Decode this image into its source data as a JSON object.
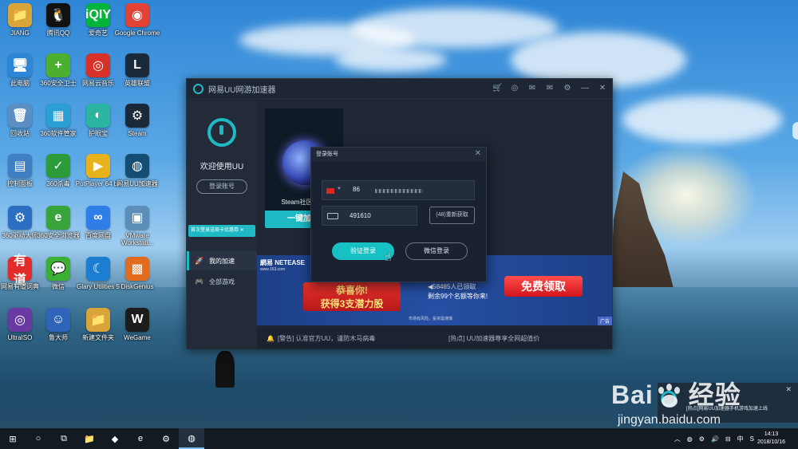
{
  "desktop": {
    "icons": [
      {
        "label": "JIANG",
        "glyph": "📁",
        "color": "#d9a53a"
      },
      {
        "label": "腾讯QQ",
        "glyph": "🐧",
        "color": "#111111"
      },
      {
        "label": "爱奇艺",
        "glyph": "iQIY",
        "color": "#00b43c"
      },
      {
        "label": "Google Chrome",
        "glyph": "◉",
        "color": "#e34133"
      },
      {
        "label": "此电脑",
        "glyph": "🖥",
        "color": "#2e86d6"
      },
      {
        "label": "360安全卫士",
        "glyph": "+",
        "color": "#4caf2f"
      },
      {
        "label": "网易云音乐",
        "glyph": "◎",
        "color": "#d7312a"
      },
      {
        "label": "英雄联盟",
        "glyph": "L",
        "color": "#1b2a3a"
      },
      {
        "label": "回收站",
        "glyph": "🗑",
        "color": "#5b8fc4"
      },
      {
        "label": "360软件管家",
        "glyph": "▦",
        "color": "#2a9fd6"
      },
      {
        "label": "护眼宝",
        "glyph": "◐",
        "color": "#2bb5a1"
      },
      {
        "label": "Steam",
        "glyph": "⚙",
        "color": "#1b2838"
      },
      {
        "label": "控制面板",
        "glyph": "▤",
        "color": "#3f7fc3"
      },
      {
        "label": "360杀毒",
        "glyph": "✓",
        "color": "#2c9c3a"
      },
      {
        "label": "PotPlayer 64 bit",
        "glyph": "▶",
        "color": "#e7b21b"
      },
      {
        "label": "网易UU加速器",
        "glyph": "◍",
        "color": "#134d73"
      },
      {
        "label": "360驱动大师",
        "glyph": "⚙",
        "color": "#2c6fc2"
      },
      {
        "label": "360安全浏览器",
        "glyph": "e",
        "color": "#3aa43c"
      },
      {
        "label": "百度网盘",
        "glyph": "∞",
        "color": "#2f7ee8"
      },
      {
        "label": "VMware Workstati...",
        "glyph": "▣",
        "color": "#5b8fb9"
      },
      {
        "label": "网易有道词典",
        "glyph": "有道",
        "color": "#e22b2b"
      },
      {
        "label": "微信",
        "glyph": "💬",
        "color": "#3cb034"
      },
      {
        "label": "Glary Utilities 5",
        "glyph": "☾",
        "color": "#1c7ed0"
      },
      {
        "label": "DiskGenius",
        "glyph": "▩",
        "color": "#e36b1d"
      },
      {
        "label": "UltraISO",
        "glyph": "◎",
        "color": "#6a3aa3"
      },
      {
        "label": "鲁大师",
        "glyph": "☺",
        "color": "#2f64b8"
      },
      {
        "label": "新建文件夹",
        "glyph": "📁",
        "color": "#d9a53a"
      },
      {
        "label": "WeGame",
        "glyph": "W",
        "color": "#1c1c1c"
      }
    ]
  },
  "uu": {
    "title": "网易UU网游加速器",
    "tools": [
      "🛒",
      "◎",
      "✉",
      "✉",
      "⚙",
      "—",
      "✕"
    ],
    "sidebar": {
      "welcome": "欢迎使用UU",
      "login_button": "登录账号",
      "tip": "首次登录送周卡优惠券 ✕",
      "nav": [
        {
          "label": "我的加速",
          "icon": "🚀"
        },
        {
          "label": "全部游戏",
          "icon": "🎮"
        }
      ]
    },
    "game": {
      "name": "Steam社区/商店",
      "accelerate_label": "一键加速"
    },
    "banner": {
      "brand": "網易 NETEASE",
      "brand_sub": "www.163.com",
      "congrats_line1": "恭喜你!",
      "congrats_line2": "获得3支潜力股",
      "count_line1": "◀58485人已领取",
      "count_line2": "剩余99个名额等你来!",
      "free_button": "免费领取",
      "risk_notice": "市场有风险，投资需谨慎",
      "ad_tag": "广告"
    },
    "notice": {
      "warning": "[警告] 认准官方UU，谨防木马病毒",
      "hot": "[热点] UU加速器尊享全网超值价"
    }
  },
  "login_dialog": {
    "title": "登录账号",
    "close": "✕",
    "country_code": "86",
    "code_value": "491610",
    "resend_label": "(48)重新获取",
    "verify_login_label": "验证登录",
    "wechat_login_label": "微信登录"
  },
  "notification": {
    "text": "[热点]网易UU加速器手机游戏加速上线",
    "close": "✕"
  },
  "watermark": {
    "brand_left": "Bai",
    "brand_right": "经验",
    "url": "jingyan.baidu.com"
  },
  "taskbar": {
    "items": [
      "⊞",
      "○",
      "⧉",
      "📁",
      "◆",
      "e",
      "⚙",
      "◍"
    ],
    "tray": [
      "︿",
      "◍",
      "⚙",
      "🔊",
      "⊟",
      "中",
      "S"
    ],
    "time": "14:13",
    "date": "2018/10/16"
  }
}
